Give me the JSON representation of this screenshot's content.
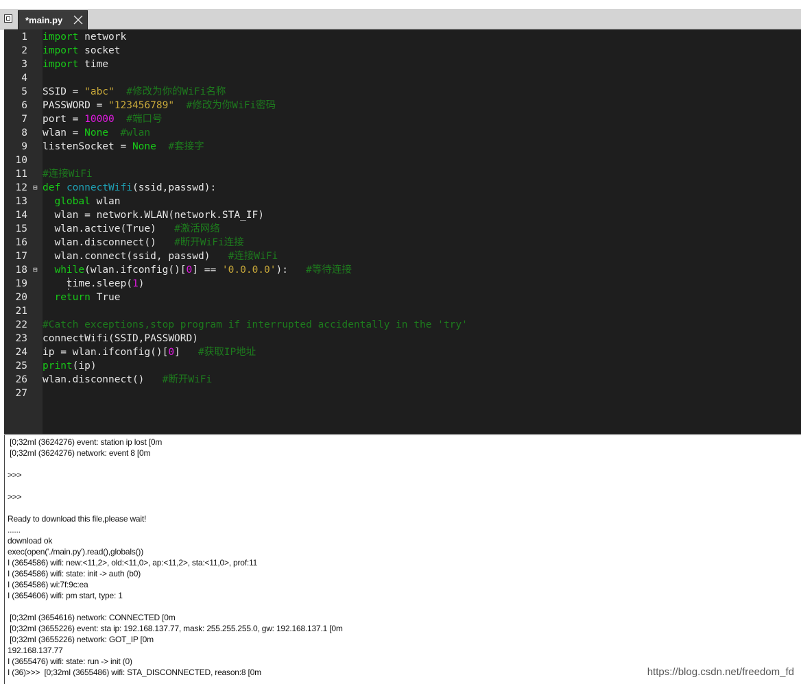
{
  "tab": {
    "label": "*main.py"
  },
  "editor": {
    "lines": [
      {
        "n": "1",
        "fold": "",
        "tokens": [
          {
            "t": "import",
            "c": "kw"
          },
          {
            "t": " network",
            "c": ""
          }
        ]
      },
      {
        "n": "2",
        "fold": "",
        "tokens": [
          {
            "t": "import",
            "c": "kw"
          },
          {
            "t": " socket",
            "c": ""
          }
        ]
      },
      {
        "n": "3",
        "fold": "",
        "tokens": [
          {
            "t": "import",
            "c": "kw"
          },
          {
            "t": " time",
            "c": ""
          }
        ]
      },
      {
        "n": "4",
        "fold": "",
        "tokens": []
      },
      {
        "n": "5",
        "fold": "",
        "tokens": [
          {
            "t": "SSID = ",
            "c": ""
          },
          {
            "t": "\"abc\"",
            "c": "str"
          },
          {
            "t": "  #修改为你的WiFi名称",
            "c": "cm"
          }
        ]
      },
      {
        "n": "6",
        "fold": "",
        "tokens": [
          {
            "t": "PASSWORD = ",
            "c": ""
          },
          {
            "t": "\"123456789\"",
            "c": "str"
          },
          {
            "t": "  #修改为你WiFi密码",
            "c": "cm"
          }
        ]
      },
      {
        "n": "7",
        "fold": "",
        "tokens": [
          {
            "t": "port = ",
            "c": ""
          },
          {
            "t": "10000",
            "c": "num"
          },
          {
            "t": "  #端口号",
            "c": "cm"
          }
        ]
      },
      {
        "n": "8",
        "fold": "",
        "tokens": [
          {
            "t": "wlan = ",
            "c": ""
          },
          {
            "t": "None",
            "c": "kw"
          },
          {
            "t": "  #wlan",
            "c": "cm"
          }
        ]
      },
      {
        "n": "9",
        "fold": "",
        "tokens": [
          {
            "t": "listenSocket = ",
            "c": ""
          },
          {
            "t": "None",
            "c": "kw"
          },
          {
            "t": "  #套接字",
            "c": "cm"
          }
        ]
      },
      {
        "n": "10",
        "fold": "",
        "tokens": []
      },
      {
        "n": "11",
        "fold": "",
        "tokens": [
          {
            "t": "#连接WiFi",
            "c": "cm"
          }
        ]
      },
      {
        "n": "12",
        "fold": "⊟",
        "tokens": [
          {
            "t": "def",
            "c": "kw"
          },
          {
            "t": " ",
            "c": ""
          },
          {
            "t": "connectWifi",
            "c": "fn"
          },
          {
            "t": "(ssid,passwd):",
            "c": ""
          }
        ]
      },
      {
        "n": "13",
        "fold": "",
        "tokens": [
          {
            "t": "  ",
            "c": ""
          },
          {
            "t": "global",
            "c": "kw"
          },
          {
            "t": " wlan",
            "c": ""
          }
        ]
      },
      {
        "n": "14",
        "fold": "",
        "tokens": [
          {
            "t": "  wlan = network.WLAN(network.STA_IF)",
            "c": ""
          }
        ]
      },
      {
        "n": "15",
        "fold": "",
        "tokens": [
          {
            "t": "  wlan.active(True)   ",
            "c": ""
          },
          {
            "t": "#激活网络",
            "c": "cm"
          }
        ]
      },
      {
        "n": "16",
        "fold": "",
        "tokens": [
          {
            "t": "  wlan.disconnect()   ",
            "c": ""
          },
          {
            "t": "#断开WiFi连接",
            "c": "cm"
          }
        ]
      },
      {
        "n": "17",
        "fold": "",
        "tokens": [
          {
            "t": "  wlan.connect(ssid, passwd)   ",
            "c": ""
          },
          {
            "t": "#连接WiFi",
            "c": "cm"
          }
        ]
      },
      {
        "n": "18",
        "fold": "⊟",
        "tokens": [
          {
            "t": "  ",
            "c": ""
          },
          {
            "t": "while",
            "c": "kw"
          },
          {
            "t": "(wlan.ifconfig()[",
            "c": ""
          },
          {
            "t": "0",
            "c": "num"
          },
          {
            "t": "] == ",
            "c": ""
          },
          {
            "t": "'0.0.0.0'",
            "c": "str"
          },
          {
            "t": "):   ",
            "c": ""
          },
          {
            "t": "#等待连接",
            "c": "cm"
          }
        ]
      },
      {
        "n": "19",
        "fold": "",
        "tokens": [
          {
            "t": "    time.sleep(",
            "c": ""
          },
          {
            "t": "1",
            "c": "num"
          },
          {
            "t": ")",
            "c": ""
          }
        ]
      },
      {
        "n": "20",
        "fold": "",
        "tokens": [
          {
            "t": "  ",
            "c": ""
          },
          {
            "t": "return",
            "c": "kw"
          },
          {
            "t": " True",
            "c": ""
          }
        ]
      },
      {
        "n": "21",
        "fold": "",
        "tokens": []
      },
      {
        "n": "22",
        "fold": "",
        "tokens": [
          {
            "t": "#Catch exceptions,stop program if interrupted accidentally in the 'try'",
            "c": "cm"
          }
        ]
      },
      {
        "n": "23",
        "fold": "",
        "tokens": [
          {
            "t": "connectWifi(SSID,PASSWORD)",
            "c": ""
          }
        ]
      },
      {
        "n": "24",
        "fold": "",
        "tokens": [
          {
            "t": "ip = wlan.ifconfig()[",
            "c": ""
          },
          {
            "t": "0",
            "c": "num"
          },
          {
            "t": "]   ",
            "c": ""
          },
          {
            "t": "#获取IP地址",
            "c": "cm"
          }
        ]
      },
      {
        "n": "25",
        "fold": "",
        "tokens": [
          {
            "t": "print",
            "c": "kw"
          },
          {
            "t": "(ip)",
            "c": ""
          }
        ]
      },
      {
        "n": "26",
        "fold": "",
        "tokens": [
          {
            "t": "wlan.disconnect()   ",
            "c": ""
          },
          {
            "t": "#断开WiFi",
            "c": "cm"
          }
        ]
      },
      {
        "n": "27",
        "fold": "",
        "tokens": []
      }
    ]
  },
  "console": {
    "lines": [
      " [0;32mI (3624276) event: station ip lost [0m",
      " [0;32mI (3624276) network: event 8 [0m",
      "",
      ">>>",
      "",
      ">>>",
      "",
      "Ready to download this file,please wait!",
      "......",
      "download ok",
      "exec(open('./main.py').read(),globals())",
      "I (3654586) wifi: new:<11,2>, old:<11,0>, ap:<11,2>, sta:<11,0>, prof:11",
      "I (3654586) wifi: state: init -> auth (b0)",
      "I (3654586) wi:7f:9c:ea",
      "I (3654606) wifi: pm start, type: 1",
      "",
      " [0;32mI (3654616) network: CONNECTED [0m",
      " [0;32mI (3655226) event: sta ip: 192.168.137.77, mask: 255.255.255.0, gw: 192.168.137.1 [0m",
      " [0;32mI (3655226) network: GOT_IP [0m",
      "192.168.137.77",
      "I (3655476) wifi: state: run -> init (0)",
      "I (36)>>>  [0;32mI (3655486) wifi: STA_DISCONNECTED, reason:8 [0m"
    ]
  },
  "watermark": "https://blog.csdn.net/freedom_fd",
  "icons": {
    "tab_icon": "window-icon",
    "close": "close-icon"
  }
}
